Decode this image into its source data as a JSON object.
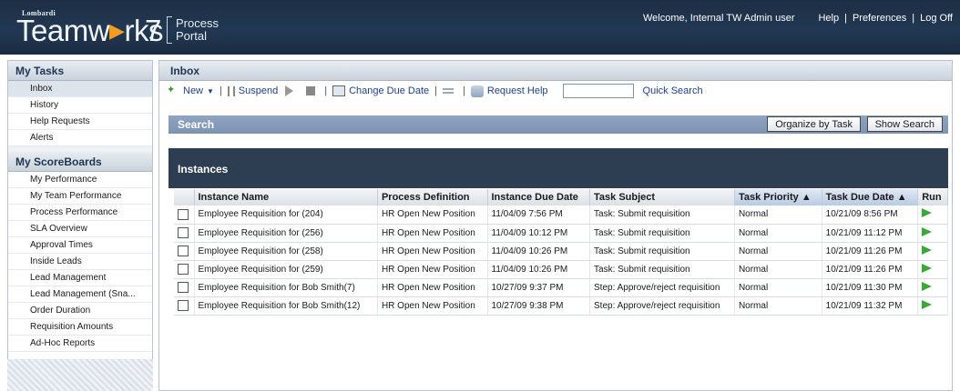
{
  "header": {
    "brand_small": "Lombardi",
    "brand_name_a": "Teamw",
    "brand_name_b": "rks",
    "brand_version": "7",
    "brand_sub_line1": "Process",
    "brand_sub_line2": "Portal",
    "welcome": "Welcome, Internal TW Admin user",
    "links": [
      "Help",
      "Preferences",
      "Log Off"
    ]
  },
  "sidebar": {
    "tasks_title": "My Tasks",
    "tasks_items": [
      "Inbox",
      "History",
      "Help Requests",
      "Alerts"
    ],
    "scoreboards_title": "My ScoreBoards",
    "scoreboards_items": [
      "My Performance",
      "My Team Performance",
      "Process Performance",
      "SLA Overview",
      "Approval Times",
      "Inside Leads",
      "Lead Management",
      "Lead Management (Sna...",
      "Order Duration",
      "Requisition Amounts",
      "Ad-Hoc Reports"
    ]
  },
  "main": {
    "title": "Inbox",
    "toolbar": {
      "new_label": "New",
      "suspend_label": "Suspend",
      "change_due_label": "Change Due Date",
      "request_help_label": "Request Help",
      "quick_search_label": "Quick Search"
    },
    "search": {
      "title": "Search",
      "organize_label": "Organize by Task",
      "show_label": "Show Search"
    },
    "instances": {
      "title": "Instances",
      "columns": [
        "Instance Name",
        "Process Definition",
        "Instance Due Date",
        "Task Subject",
        "Task Priority ▲",
        "Task Due Date ▲",
        "Run"
      ],
      "rows": [
        [
          "Employee Requisition for (204)",
          "HR Open New Position",
          "11/04/09 7:56 PM",
          "Task: Submit requisition",
          "Normal",
          "10/21/09 8:56 PM"
        ],
        [
          "Employee Requisition for (256)",
          "HR Open New Position",
          "11/04/09 10:12 PM",
          "Task: Submit requisition",
          "Normal",
          "10/21/09 11:12 PM"
        ],
        [
          "Employee Requisition for (258)",
          "HR Open New Position",
          "11/04/09 10:26 PM",
          "Task: Submit requisition",
          "Normal",
          "10/21/09 11:26 PM"
        ],
        [
          "Employee Requisition for (259)",
          "HR Open New Position",
          "11/04/09 10:26 PM",
          "Task: Submit requisition",
          "Normal",
          "10/21/09 11:26 PM"
        ],
        [
          "Employee Requisition for Bob Smith(7)",
          "HR Open New Position",
          "10/27/09 9:37 PM",
          "Step: Approve/reject requisition",
          "Normal",
          "10/21/09 11:30 PM"
        ],
        [
          "Employee Requisition for Bob Smith(12)",
          "HR Open New Position",
          "10/27/09 9:38 PM",
          "Step: Approve/reject requisition",
          "Normal",
          "10/21/09 11:32 PM"
        ]
      ]
    }
  }
}
